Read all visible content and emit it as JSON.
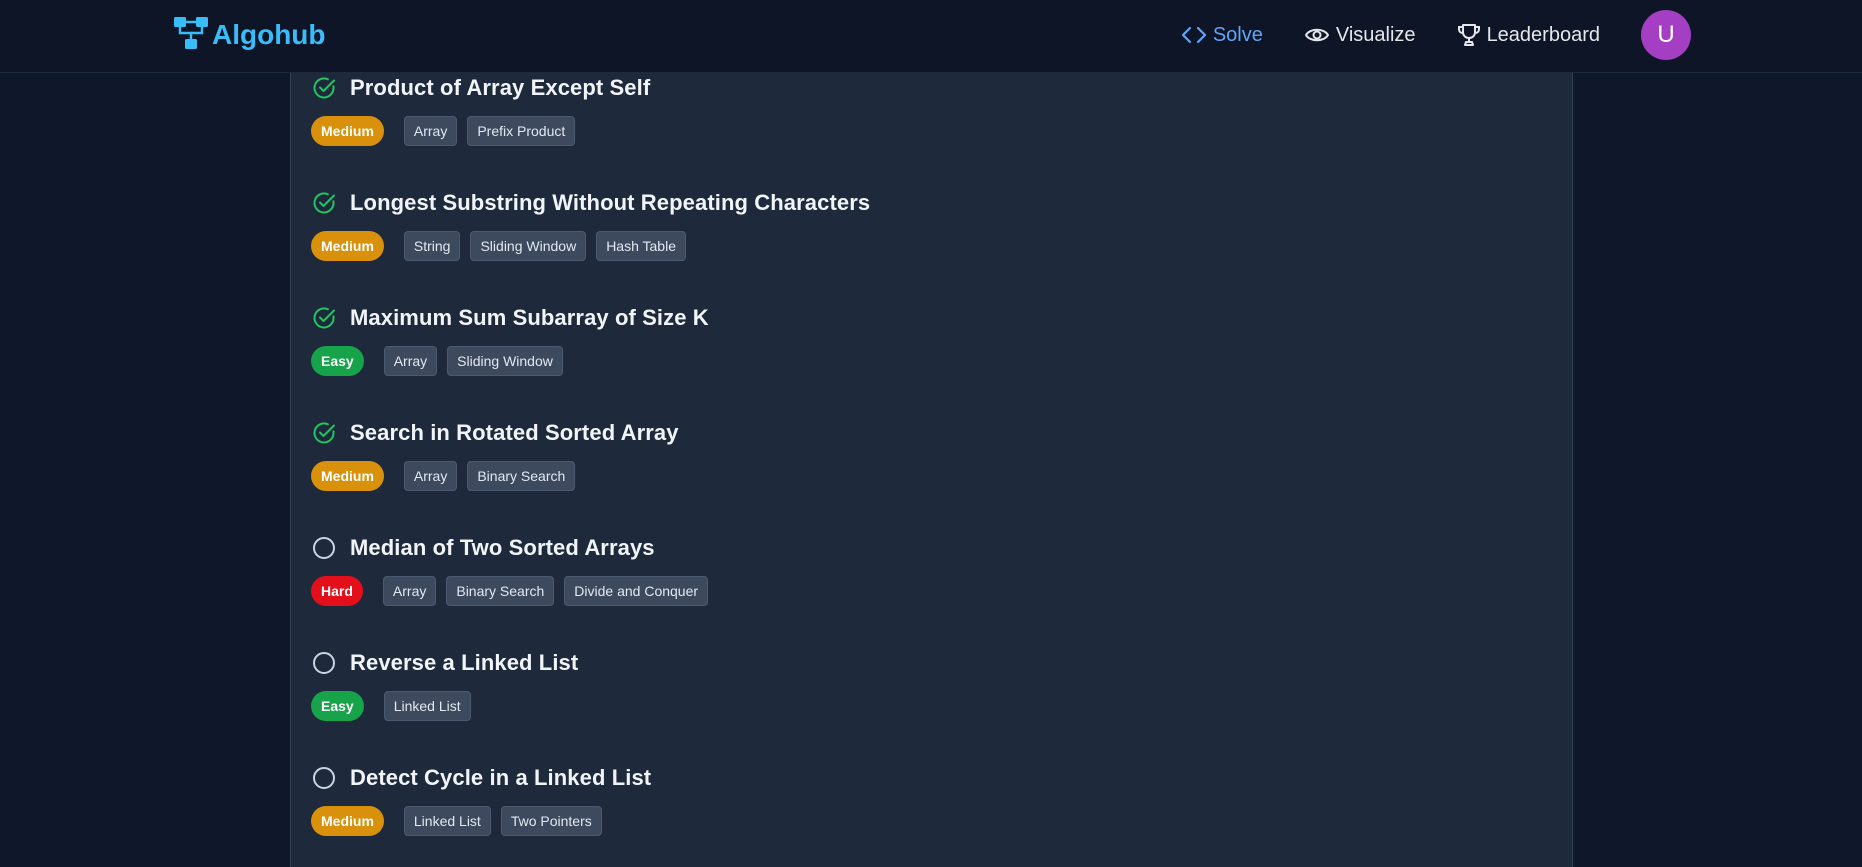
{
  "navbar": {
    "brand": "Algohub",
    "links": {
      "solve": "Solve",
      "visualize": "Visualize",
      "leaderboard": "Leaderboard"
    },
    "avatar_initial": "U"
  },
  "colors": {
    "easy": "#16a34a",
    "medium": "#d9900b",
    "hard": "#e3101c",
    "solved": "#22c55e",
    "brand": "#38bdf8",
    "active_link": "#60a5fa"
  },
  "problems": [
    {
      "title": "Product of Array Except Self",
      "solved": true,
      "difficulty": "Medium",
      "tags": [
        "Array",
        "Prefix Product"
      ]
    },
    {
      "title": "Longest Substring Without Repeating Characters",
      "solved": true,
      "difficulty": "Medium",
      "tags": [
        "String",
        "Sliding Window",
        "Hash Table"
      ]
    },
    {
      "title": "Maximum Sum Subarray of Size K",
      "solved": true,
      "difficulty": "Easy",
      "tags": [
        "Array",
        "Sliding Window"
      ]
    },
    {
      "title": "Search in Rotated Sorted Array",
      "solved": true,
      "difficulty": "Medium",
      "tags": [
        "Array",
        "Binary Search"
      ]
    },
    {
      "title": "Median of Two Sorted Arrays",
      "solved": false,
      "difficulty": "Hard",
      "tags": [
        "Array",
        "Binary Search",
        "Divide and Conquer"
      ]
    },
    {
      "title": "Reverse a Linked List",
      "solved": false,
      "difficulty": "Easy",
      "tags": [
        "Linked List"
      ]
    },
    {
      "title": "Detect Cycle in a Linked List",
      "solved": false,
      "difficulty": "Medium",
      "tags": [
        "Linked List",
        "Two Pointers"
      ]
    }
  ]
}
